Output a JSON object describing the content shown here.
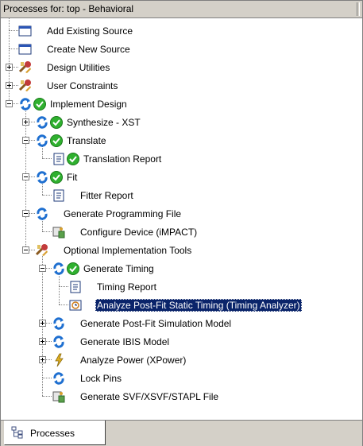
{
  "panel": {
    "title": "Processes for: top - Behavioral",
    "tab_label": "Processes"
  },
  "tree": {
    "items": [
      {
        "label": "Add Existing Source",
        "icon": "window-icon",
        "status": "",
        "indent": 0,
        "expander": "none",
        "selected": false
      },
      {
        "label": "Create New Source",
        "icon": "window-icon",
        "status": "",
        "indent": 0,
        "expander": "none",
        "selected": false
      },
      {
        "label": "Design Utilities",
        "icon": "tools-icon",
        "status": "",
        "indent": 0,
        "expander": "plus",
        "selected": false
      },
      {
        "label": "User Constraints",
        "icon": "tools-icon",
        "status": "",
        "indent": 0,
        "expander": "plus",
        "selected": false
      },
      {
        "label": "Implement Design",
        "icon": "process-icon",
        "status": "check-icon",
        "indent": 0,
        "expander": "minus",
        "selected": false
      },
      {
        "label": "Synthesize - XST",
        "icon": "process-icon",
        "status": "check-icon",
        "indent": 1,
        "expander": "plus",
        "selected": false
      },
      {
        "label": "Translate",
        "icon": "process-icon",
        "status": "check-icon",
        "indent": 1,
        "expander": "minus",
        "selected": false
      },
      {
        "label": "Translation Report",
        "icon": "report-icon",
        "status": "check-icon",
        "indent": 2,
        "expander": "none",
        "selected": false
      },
      {
        "label": "Fit",
        "icon": "process-icon",
        "status": "check-icon",
        "indent": 1,
        "expander": "minus",
        "selected": false
      },
      {
        "label": "Fitter Report",
        "icon": "report-icon",
        "status": "",
        "indent": 2,
        "expander": "none",
        "selected": false
      },
      {
        "label": "Generate Programming File",
        "icon": "process-icon",
        "status": "",
        "indent": 1,
        "expander": "minus",
        "selected": false
      },
      {
        "label": "Configure Device (iMPACT)",
        "icon": "device-icon",
        "status": "",
        "indent": 2,
        "expander": "none",
        "selected": false
      },
      {
        "label": "Optional Implementation Tools",
        "icon": "tools-icon",
        "status": "",
        "indent": 1,
        "expander": "minus",
        "selected": false
      },
      {
        "label": "Generate Timing",
        "icon": "process-icon",
        "status": "check-icon",
        "indent": 2,
        "expander": "minus",
        "selected": false
      },
      {
        "label": "Timing Report",
        "icon": "report-icon",
        "status": "",
        "indent": 3,
        "expander": "none",
        "selected": false
      },
      {
        "label": "Analyze Post-Fit Static Timing (Timing Analyzer)",
        "icon": "clock-icon",
        "status": "",
        "indent": 3,
        "expander": "none",
        "selected": true
      },
      {
        "label": "Generate Post-Fit Simulation Model",
        "icon": "process-icon",
        "status": "",
        "indent": 2,
        "expander": "plus",
        "selected": false
      },
      {
        "label": "Generate IBIS Model",
        "icon": "process-icon",
        "status": "",
        "indent": 2,
        "expander": "plus",
        "selected": false
      },
      {
        "label": "Analyze Power (XPower)",
        "icon": "power-icon",
        "status": "",
        "indent": 2,
        "expander": "plus",
        "selected": false
      },
      {
        "label": "Lock Pins",
        "icon": "process-icon",
        "status": "",
        "indent": 2,
        "expander": "none",
        "selected": false
      },
      {
        "label": "Generate SVF/XSVF/STAPL File",
        "icon": "device-icon",
        "status": "",
        "indent": 2,
        "expander": "none",
        "selected": false
      }
    ]
  },
  "colors": {
    "selection": "#0a246a",
    "panel_face": "#d4d0c8",
    "check_green": "#2fb02f",
    "arrow_blue": "#1e6fd0"
  }
}
